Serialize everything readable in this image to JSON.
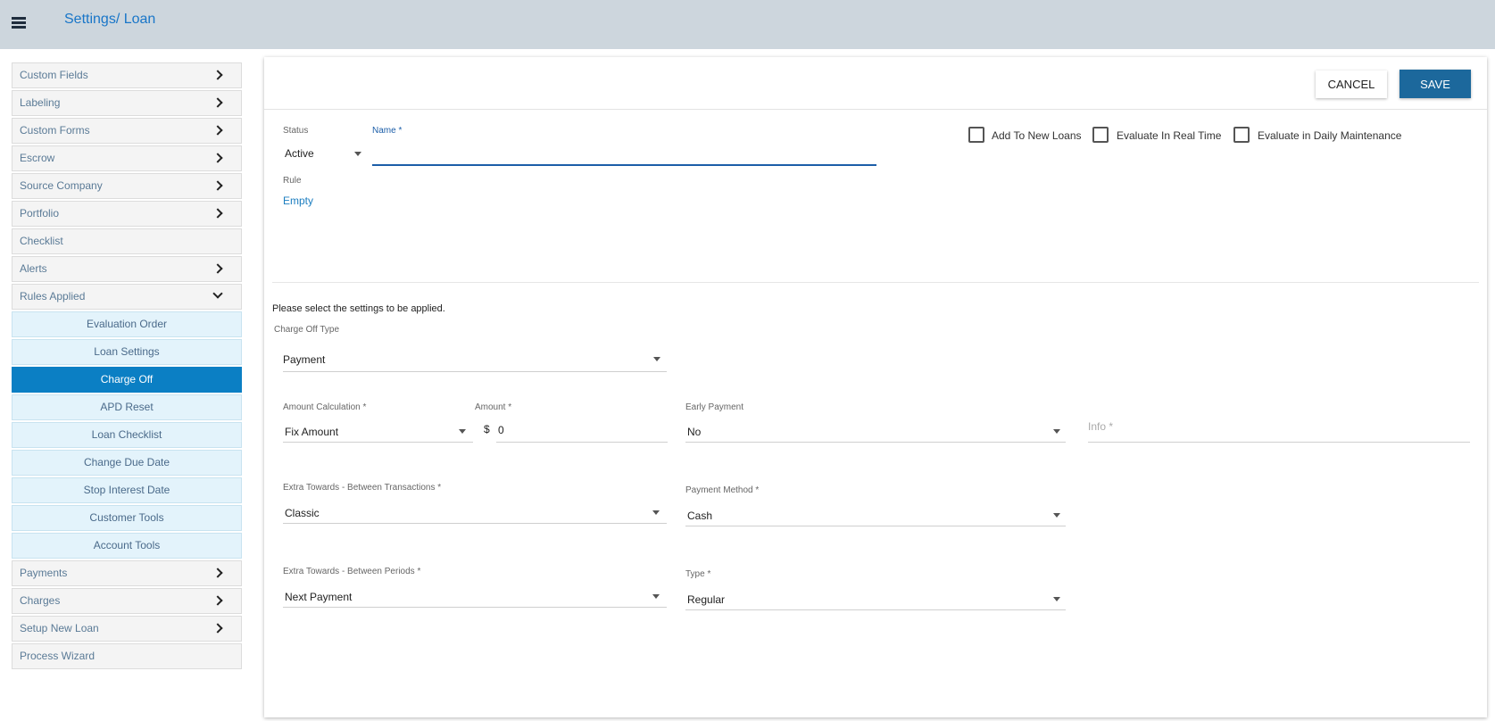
{
  "header": {
    "breadcrumb_root": "Settings",
    "breadcrumb_sep": "/",
    "breadcrumb_current": "Loan"
  },
  "sidebar": {
    "items": [
      {
        "label": "Custom Fields"
      },
      {
        "label": "Labeling"
      },
      {
        "label": "Custom Forms"
      },
      {
        "label": "Escrow"
      },
      {
        "label": "Source Company"
      },
      {
        "label": "Portfolio"
      },
      {
        "label": "Checklist"
      },
      {
        "label": "Alerts"
      },
      {
        "label": "Rules Applied"
      }
    ],
    "subitems": [
      {
        "label": "Evaluation Order"
      },
      {
        "label": "Loan Settings"
      },
      {
        "label": "Charge Off"
      },
      {
        "label": "APD Reset"
      },
      {
        "label": "Loan Checklist"
      },
      {
        "label": "Change Due Date"
      },
      {
        "label": "Stop Interest Date"
      },
      {
        "label": "Customer Tools"
      },
      {
        "label": "Account Tools"
      }
    ],
    "bottom_items": [
      {
        "label": "Payments"
      },
      {
        "label": "Charges"
      },
      {
        "label": "Setup New Loan"
      },
      {
        "label": "Process Wizard"
      }
    ]
  },
  "toolbar": {
    "cancel_label": "CANCEL",
    "save_label": "SAVE"
  },
  "form": {
    "status_label": "Status",
    "status_value": "Active",
    "name_label": "Name *",
    "name_value": "",
    "rule_label": "Rule",
    "rule_value": "Empty",
    "checkboxes": {
      "add_to_new_loans": "Add To New Loans",
      "evaluate_real_time": "Evaluate In Real Time",
      "evaluate_daily": "Evaluate in Daily Maintenance"
    },
    "instructions": "Please select the settings to be applied.",
    "charge_off_type_label": "Charge Off Type",
    "charge_off_type_value": "Payment",
    "amount_calc_label": "Amount Calculation *",
    "amount_calc_value": "Fix Amount",
    "amount_label": "Amount *",
    "amount_prefix": "$",
    "amount_value": "0",
    "early_payment_label": "Early Payment",
    "early_payment_value": "No",
    "info_placeholder": "Info *",
    "extra_tx_label": "Extra Towards - Between Transactions *",
    "extra_tx_value": "Classic",
    "payment_method_label": "Payment Method *",
    "payment_method_value": "Cash",
    "extra_periods_label": "Extra Towards - Between Periods *",
    "extra_periods_value": "Next Payment",
    "type_label": "Type *",
    "type_value": "Regular"
  }
}
